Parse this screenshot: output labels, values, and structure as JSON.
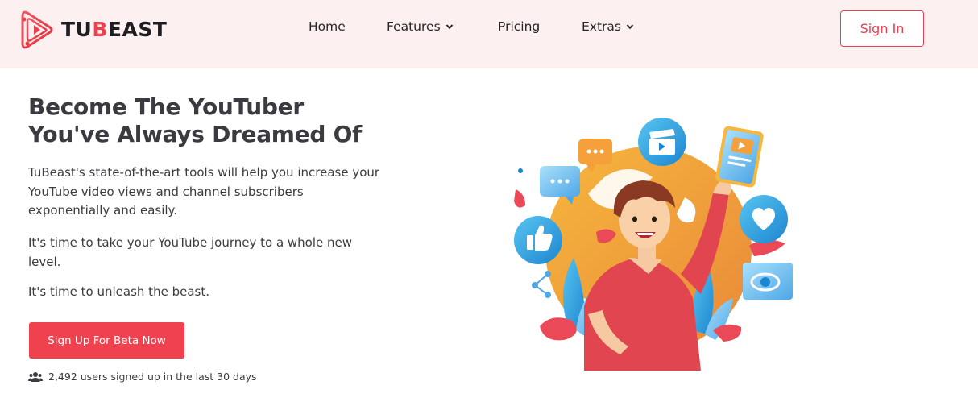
{
  "brand": {
    "logo_text_1": "TU",
    "logo_text_2": "B",
    "logo_text_3": "EAST",
    "accent_color": "#f0404f"
  },
  "nav": {
    "items": [
      {
        "label": "Home",
        "has_dropdown": false
      },
      {
        "label": "Features",
        "has_dropdown": true
      },
      {
        "label": "Pricing",
        "has_dropdown": false
      },
      {
        "label": "Extras",
        "has_dropdown": true
      }
    ],
    "signin_label": "Sign In"
  },
  "hero": {
    "title_line1": "Become The YouTuber",
    "title_line2": "You've Always Dreamed Of",
    "paragraph1": "TuBeast's state-of-the-art tools will help you increase your YouTube video views and channel subscribers exponentially and easily.",
    "paragraph2": "It's time to take your YouTube journey to a whole new level.",
    "paragraph3": "It's time to unleash the beast.",
    "cta_label": "Sign Up For Beta Now",
    "signup_count_text": "2,492 users signed up in the last 30 days"
  },
  "illustration": {
    "icons": [
      "chat-bubble-icon",
      "video-clapper-icon",
      "video-card-icon",
      "heart-icon",
      "like-icon",
      "eye-icon",
      "share-icon"
    ]
  }
}
